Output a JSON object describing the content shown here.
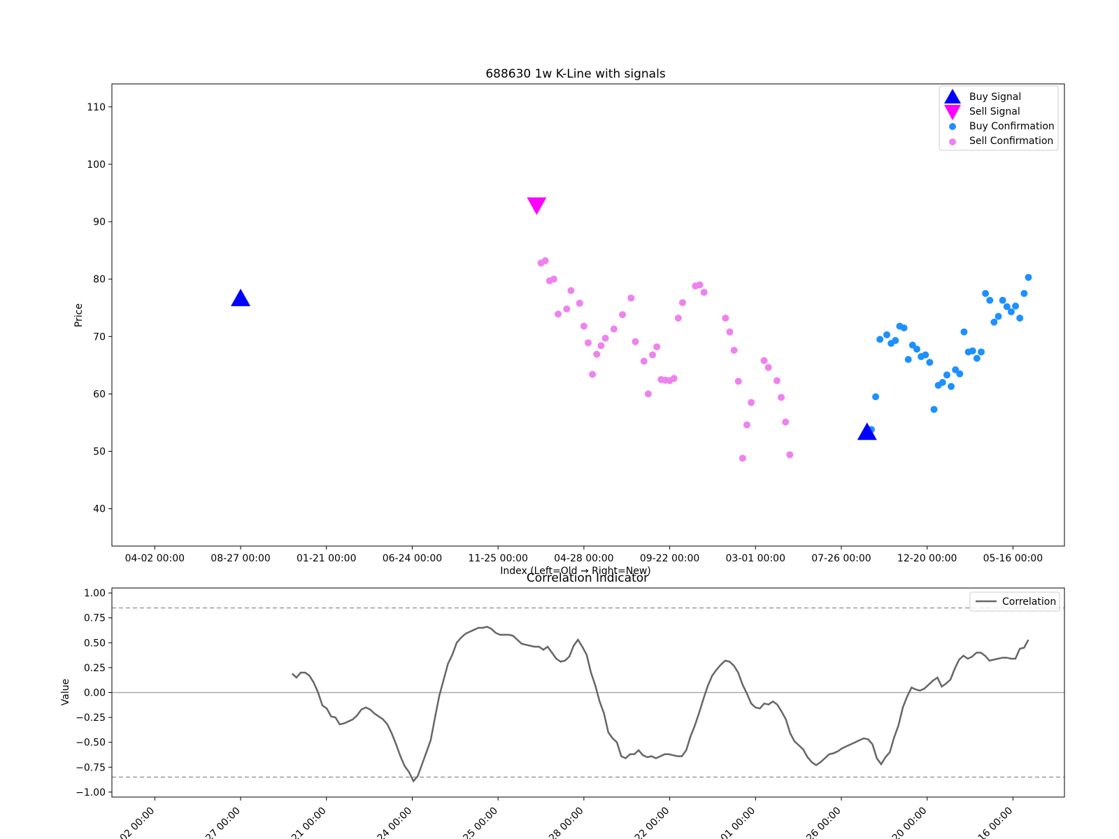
{
  "colors": {
    "up": "#008000",
    "down": "#ff0000",
    "buy_signal": "#0000ff",
    "sell_signal": "#ff00ff",
    "buy_confirmation": "#1e90ff",
    "sell_confirmation": "#ee82ee",
    "correlation": "#666666",
    "threshold": "#999999",
    "zero_line": "#aaaaaa"
  },
  "chart_data": [
    {
      "type": "candlestick",
      "title": "688630 1w K-Line with signals",
      "xlabel": "Index (Left=Old → Right=New)",
      "ylabel": "Price",
      "xlim": [
        -5,
        106
      ],
      "ylim": [
        33.5,
        114
      ],
      "yticks": [
        40,
        50,
        60,
        70,
        80,
        90,
        100,
        110
      ],
      "xticks": [
        {
          "index": 0,
          "label": "04-02 00:00"
        },
        {
          "index": 10,
          "label": "08-27 00:00"
        },
        {
          "index": 20,
          "label": "01-21 00:00"
        },
        {
          "index": 30,
          "label": "06-24 00:00"
        },
        {
          "index": 40,
          "label": "11-25 00:00"
        },
        {
          "index": 50,
          "label": "04-28 00:00"
        },
        {
          "index": 60,
          "label": "09-22 00:00"
        },
        {
          "index": 70,
          "label": "03-01 00:00"
        },
        {
          "index": 80,
          "label": "07-26 00:00"
        },
        {
          "index": 90,
          "label": "12-20 00:00"
        },
        {
          "index": 100,
          "label": "05-16 00:00"
        }
      ],
      "candles": [],
      "legend": {
        "placement": "top-right",
        "entries": [
          {
            "label": "Buy Signal",
            "marker": "triangle-up",
            "color": "#0000ff"
          },
          {
            "label": "Sell Signal",
            "marker": "triangle-down",
            "color": "#ff00ff"
          },
          {
            "label": "Buy Confirmation",
            "marker": "dot",
            "color": "#1e90ff"
          },
          {
            "label": "Sell Confirmation",
            "marker": "dot",
            "color": "#ee82ee"
          }
        ]
      },
      "buy_signals": [
        {
          "x": 10,
          "y": 76.5
        },
        {
          "x": 83,
          "y": 53.2
        }
      ],
      "sell_signals": [
        {
          "x": 44.5,
          "y": 93.0
        }
      ],
      "buy_confirmations": [
        {
          "x": 83.5,
          "y": 53.8
        },
        {
          "x": 84.0,
          "y": 59.5
        },
        {
          "x": 84.5,
          "y": 69.5
        },
        {
          "x": 85.3,
          "y": 70.3
        },
        {
          "x": 85.8,
          "y": 68.8
        },
        {
          "x": 86.3,
          "y": 69.3
        },
        {
          "x": 86.8,
          "y": 71.8
        },
        {
          "x": 87.3,
          "y": 71.5
        },
        {
          "x": 87.8,
          "y": 66.0
        },
        {
          "x": 88.3,
          "y": 68.5
        },
        {
          "x": 88.8,
          "y": 67.8
        },
        {
          "x": 89.3,
          "y": 66.5
        },
        {
          "x": 89.8,
          "y": 66.8
        },
        {
          "x": 90.3,
          "y": 65.5
        },
        {
          "x": 90.8,
          "y": 57.3
        },
        {
          "x": 91.3,
          "y": 61.5
        },
        {
          "x": 91.8,
          "y": 62.0
        },
        {
          "x": 92.3,
          "y": 63.3
        },
        {
          "x": 92.8,
          "y": 61.3
        },
        {
          "x": 93.3,
          "y": 64.2
        },
        {
          "x": 93.8,
          "y": 63.5
        },
        {
          "x": 94.3,
          "y": 70.8
        },
        {
          "x": 94.8,
          "y": 67.3
        },
        {
          "x": 95.3,
          "y": 67.5
        },
        {
          "x": 95.8,
          "y": 66.2
        },
        {
          "x": 96.3,
          "y": 67.3
        },
        {
          "x": 96.8,
          "y": 77.5
        },
        {
          "x": 97.3,
          "y": 76.3
        },
        {
          "x": 97.8,
          "y": 72.5
        },
        {
          "x": 98.3,
          "y": 73.5
        },
        {
          "x": 98.8,
          "y": 76.3
        },
        {
          "x": 99.3,
          "y": 75.2
        },
        {
          "x": 99.8,
          "y": 74.3
        },
        {
          "x": 100.3,
          "y": 75.3
        },
        {
          "x": 100.8,
          "y": 73.2
        },
        {
          "x": 101.3,
          "y": 77.5
        },
        {
          "x": 101.8,
          "y": 80.3
        }
      ],
      "sell_confirmations": [
        {
          "x": 45.0,
          "y": 82.8
        },
        {
          "x": 45.5,
          "y": 83.2
        },
        {
          "x": 46.0,
          "y": 79.7
        },
        {
          "x": 46.5,
          "y": 80.0
        },
        {
          "x": 47.0,
          "y": 73.9
        },
        {
          "x": 48.0,
          "y": 74.8
        },
        {
          "x": 48.5,
          "y": 78.0
        },
        {
          "x": 49.5,
          "y": 75.8
        },
        {
          "x": 50.0,
          "y": 71.8
        },
        {
          "x": 50.5,
          "y": 68.9
        },
        {
          "x": 51.0,
          "y": 63.4
        },
        {
          "x": 51.5,
          "y": 66.9
        },
        {
          "x": 52.0,
          "y": 68.4
        },
        {
          "x": 52.5,
          "y": 69.7
        },
        {
          "x": 53.5,
          "y": 71.3
        },
        {
          "x": 54.5,
          "y": 73.8
        },
        {
          "x": 55.5,
          "y": 76.7
        },
        {
          "x": 56.0,
          "y": 69.1
        },
        {
          "x": 57.0,
          "y": 65.7
        },
        {
          "x": 57.5,
          "y": 60.0
        },
        {
          "x": 58.0,
          "y": 66.8
        },
        {
          "x": 58.5,
          "y": 68.2
        },
        {
          "x": 59.0,
          "y": 62.5
        },
        {
          "x": 59.5,
          "y": 62.4
        },
        {
          "x": 60.0,
          "y": 62.3
        },
        {
          "x": 60.5,
          "y": 62.7
        },
        {
          "x": 61.0,
          "y": 73.2
        },
        {
          "x": 61.5,
          "y": 75.9
        },
        {
          "x": 63.0,
          "y": 78.8
        },
        {
          "x": 63.5,
          "y": 79.0
        },
        {
          "x": 64.0,
          "y": 77.7
        },
        {
          "x": 66.5,
          "y": 73.2
        },
        {
          "x": 67.0,
          "y": 70.8
        },
        {
          "x": 67.5,
          "y": 67.6
        },
        {
          "x": 68.0,
          "y": 62.2
        },
        {
          "x": 68.5,
          "y": 48.8
        },
        {
          "x": 69.0,
          "y": 54.6
        },
        {
          "x": 69.5,
          "y": 58.5
        },
        {
          "x": 71.0,
          "y": 65.8
        },
        {
          "x": 71.5,
          "y": 64.6
        },
        {
          "x": 72.5,
          "y": 62.3
        },
        {
          "x": 73.0,
          "y": 59.4
        },
        {
          "x": 73.5,
          "y": 55.1
        },
        {
          "x": 74.0,
          "y": 49.4
        }
      ]
    },
    {
      "type": "line",
      "title": "Correlation Indicator",
      "xlabel": "",
      "ylabel": "Value",
      "xlim": [
        -5,
        106
      ],
      "ylim": [
        -1.05,
        1.05
      ],
      "yticks": [
        -1.0,
        -0.75,
        -0.5,
        -0.25,
        0.0,
        0.25,
        0.5,
        0.75,
        1.0
      ],
      "ytick_labels": [
        "−1.00",
        "−0.75",
        "−0.50",
        "−0.25",
        "0.00",
        "0.25",
        "0.50",
        "0.75",
        "1.00"
      ],
      "xtick_labels": [
        "02 00:00",
        "27 00:00",
        "21 00:00",
        "24 00:00",
        "25 00:00",
        "28 00:00",
        "22 00:00",
        "01 00:00",
        "26 00:00",
        "20 00:00",
        "16 00:00"
      ],
      "thresholds": [
        0.85,
        -0.85
      ],
      "zero_line": 0,
      "legend": {
        "placement": "top-right",
        "entries": [
          {
            "label": "Correlation",
            "color": "#666666"
          }
        ]
      },
      "series": [
        {
          "name": "Correlation",
          "x_start": 16,
          "values": [
            0.19,
            0.15,
            0.2,
            0.2,
            0.17,
            0.1,
            0.0,
            -0.13,
            -0.16,
            -0.24,
            -0.25,
            -0.32,
            -0.31,
            -0.29,
            -0.27,
            -0.23,
            -0.17,
            -0.15,
            -0.17,
            -0.21,
            -0.24,
            -0.27,
            -0.32,
            -0.41,
            -0.52,
            -0.64,
            -0.74,
            -0.8,
            -0.89,
            -0.84,
            -0.72,
            -0.6,
            -0.48,
            -0.25,
            -0.03,
            0.13,
            0.29,
            0.38,
            0.5,
            0.55,
            0.59,
            0.61,
            0.63,
            0.65,
            0.65,
            0.66,
            0.64,
            0.6,
            0.58,
            0.58,
            0.58,
            0.57,
            0.53,
            0.49,
            0.48,
            0.47,
            0.46,
            0.46,
            0.43,
            0.46,
            0.4,
            0.34,
            0.31,
            0.32,
            0.36,
            0.47,
            0.53,
            0.46,
            0.38,
            0.2,
            0.07,
            -0.09,
            -0.21,
            -0.4,
            -0.46,
            -0.5,
            -0.64,
            -0.66,
            -0.62,
            -0.62,
            -0.58,
            -0.63,
            -0.65,
            -0.64,
            -0.66,
            -0.64,
            -0.62,
            -0.62,
            -0.63,
            -0.64,
            -0.64,
            -0.58,
            -0.44,
            -0.33,
            -0.2,
            -0.06,
            0.07,
            0.17,
            0.23,
            0.28,
            0.32,
            0.31,
            0.27,
            0.2,
            0.08,
            -0.01,
            -0.11,
            -0.15,
            -0.16,
            -0.11,
            -0.12,
            -0.09,
            -0.12,
            -0.19,
            -0.27,
            -0.41,
            -0.49,
            -0.53,
            -0.57,
            -0.65,
            -0.7,
            -0.73,
            -0.7,
            -0.66,
            -0.62,
            -0.61,
            -0.59,
            -0.56,
            -0.54,
            -0.52,
            -0.5,
            -0.48,
            -0.46,
            -0.47,
            -0.52,
            -0.66,
            -0.72,
            -0.65,
            -0.6,
            -0.45,
            -0.33,
            -0.15,
            -0.04,
            0.05,
            0.03,
            0.02,
            0.04,
            0.08,
            0.12,
            0.15,
            0.06,
            0.09,
            0.13,
            0.24,
            0.33,
            0.37,
            0.34,
            0.36,
            0.4,
            0.4,
            0.37,
            0.32,
            0.33,
            0.34,
            0.35,
            0.35,
            0.34,
            0.34,
            0.44,
            0.45,
            0.53
          ]
        }
      ]
    }
  ]
}
